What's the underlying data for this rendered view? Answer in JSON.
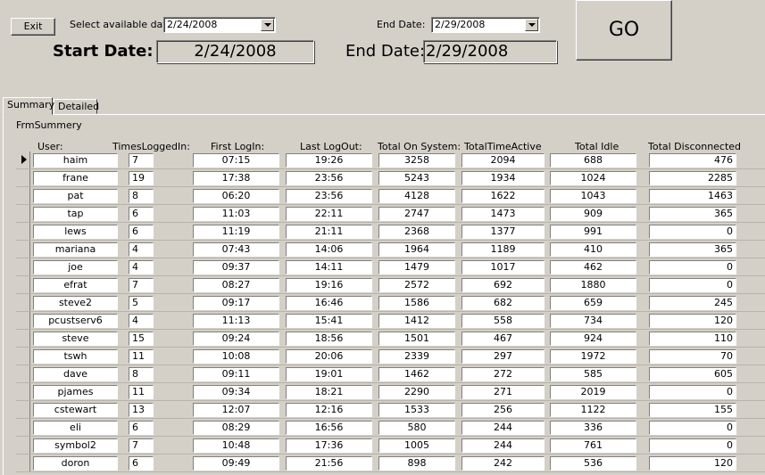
{
  "toolbar": {
    "exit_label": "Exit",
    "select_date_label": "Select available date:",
    "select_date_value": "2/24/2008",
    "end_date_label": "End Date:",
    "end_date_value": "2/29/2008",
    "go_label": "GO",
    "start_date_big_label": "Start Date:",
    "start_date_big_value": "2/24/2008",
    "end_date_big_label": "End Date:",
    "end_date_big_value": "2/29/2008"
  },
  "tabs": [
    {
      "label": "Summary",
      "active": true
    },
    {
      "label": "Detailed",
      "active": false
    }
  ],
  "subform_label": "FrmSummery",
  "columns": [
    "User:",
    "TimesLoggedIn:",
    "First LogIn:",
    "Last LogOut:",
    "Total On System:",
    "TotalTimeActive",
    "Total Idle",
    "Total Disconnected"
  ],
  "rows": [
    [
      "haim",
      "7",
      "07:15",
      "19:26",
      "3258",
      "2094",
      "688",
      "476"
    ],
    [
      "frane",
      "19",
      "17:38",
      "23:56",
      "5243",
      "1934",
      "1024",
      "2285"
    ],
    [
      "pat",
      "8",
      "06:20",
      "23:56",
      "4128",
      "1622",
      "1043",
      "1463"
    ],
    [
      "tap",
      "6",
      "11:03",
      "22:11",
      "2747",
      "1473",
      "909",
      "365"
    ],
    [
      "lews",
      "6",
      "11:19",
      "21:11",
      "2368",
      "1377",
      "991",
      "0"
    ],
    [
      "mariana",
      "4",
      "07:43",
      "14:06",
      "1964",
      "1189",
      "410",
      "365"
    ],
    [
      "joe",
      "4",
      "09:37",
      "14:11",
      "1479",
      "1017",
      "462",
      "0"
    ],
    [
      "efrat",
      "7",
      "08:27",
      "19:16",
      "2572",
      "692",
      "1880",
      "0"
    ],
    [
      "steve2",
      "5",
      "09:17",
      "16:46",
      "1586",
      "682",
      "659",
      "245"
    ],
    [
      "pcustserv6",
      "4",
      "11:13",
      "15:41",
      "1412",
      "558",
      "734",
      "120"
    ],
    [
      "steve",
      "15",
      "09:24",
      "18:56",
      "1501",
      "467",
      "924",
      "110"
    ],
    [
      "tswh",
      "11",
      "10:08",
      "20:06",
      "2339",
      "297",
      "1972",
      "70"
    ],
    [
      "dave",
      "8",
      "09:11",
      "19:01",
      "1462",
      "272",
      "585",
      "605"
    ],
    [
      "pjames",
      "11",
      "09:34",
      "18:21",
      "2290",
      "271",
      "2019",
      "0"
    ],
    [
      "cstewart",
      "13",
      "12:07",
      "12:16",
      "1533",
      "256",
      "1122",
      "155"
    ],
    [
      "eli",
      "6",
      "08:29",
      "16:56",
      "580",
      "244",
      "336",
      "0"
    ],
    [
      "symbol2",
      "7",
      "10:48",
      "17:36",
      "1005",
      "244",
      "761",
      "0"
    ],
    [
      "doron",
      "6",
      "09:49",
      "21:56",
      "898",
      "242",
      "536",
      "120"
    ]
  ]
}
